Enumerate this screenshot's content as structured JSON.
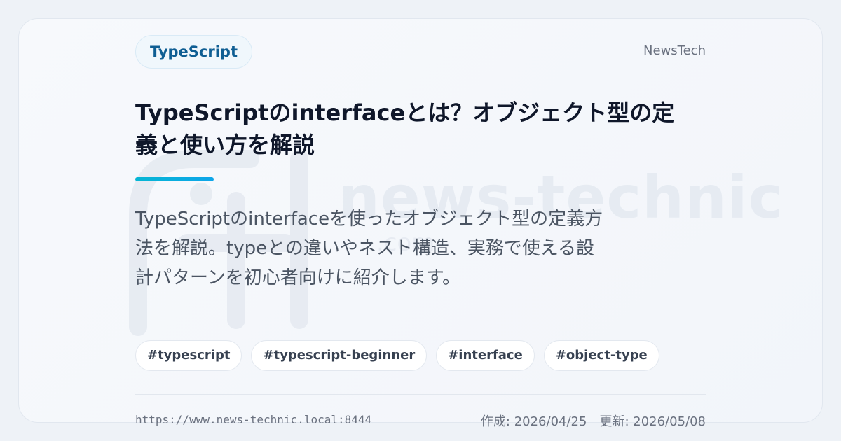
{
  "header": {
    "category": "TypeScript",
    "site_name": "NewsTech"
  },
  "article": {
    "title": "TypeScriptのinterfaceとは？オブジェクト型の定義と使い方を解説",
    "description": "TypeScriptのinterfaceを使ったオブジェクト型の定義方法を解説。typeとの違いやネスト構造、実務で使える設計パターンを初心者向けに紹介します。",
    "tags": [
      "#typescript",
      "#typescript-beginner",
      "#interface",
      "#object-type"
    ]
  },
  "watermark": {
    "text": "news-technic",
    "sub": ".com"
  },
  "footer": {
    "url": "https://www.news-technic.local:8444",
    "created": "作成: 2026/04/25",
    "updated": "更新: 2026/05/08"
  },
  "colors": {
    "accent_start": "#06b6d4",
    "accent_end": "#0ea5e9",
    "category_text": "#0f5e93",
    "title_text": "#0f172a",
    "card_background": "#f5f8fc"
  },
  "icons": {
    "watermark_logo": "news-technic-logo-icon"
  }
}
